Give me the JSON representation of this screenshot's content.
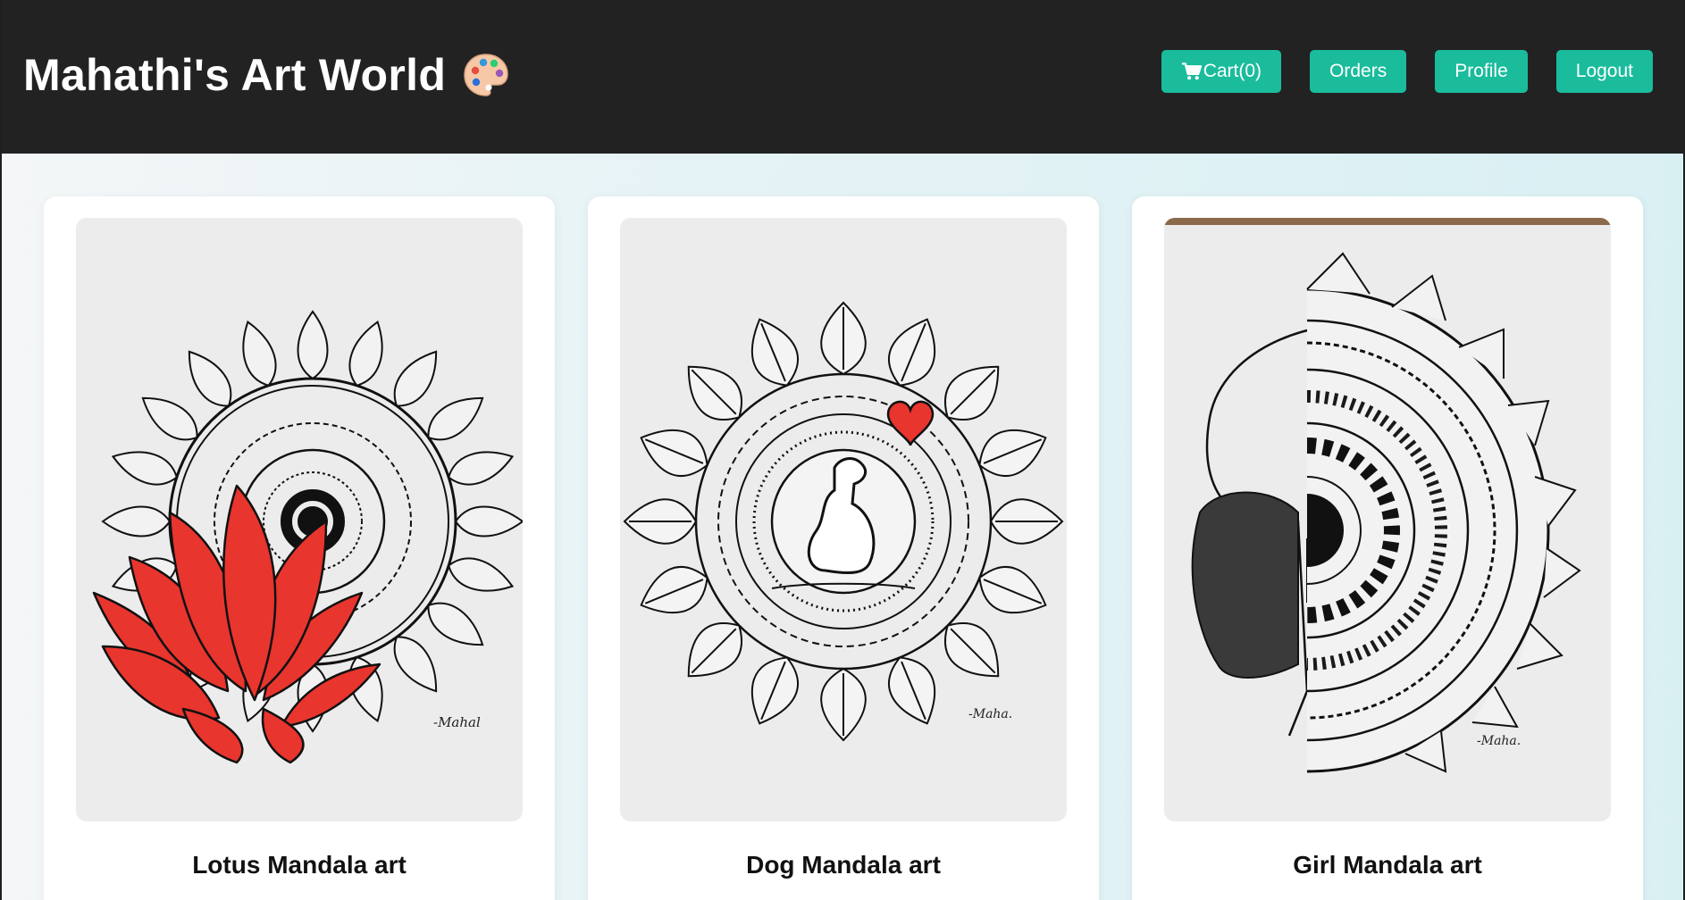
{
  "header": {
    "title": "Mahathi's Art World",
    "brand_icon": "artist-palette-icon"
  },
  "nav": {
    "cart_label": "Cart(0)",
    "cart_icon": "shopping-cart-icon",
    "orders_label": "Orders",
    "profile_label": "Profile",
    "logout_label": "Logout"
  },
  "colors": {
    "header_bg": "#222222",
    "button_bg": "#1abc9c",
    "lotus_red": "#e8352e"
  },
  "products": [
    {
      "title": "Lotus Mandala art"
    },
    {
      "title": "Dog Mandala art"
    },
    {
      "title": "Girl Mandala art"
    }
  ]
}
